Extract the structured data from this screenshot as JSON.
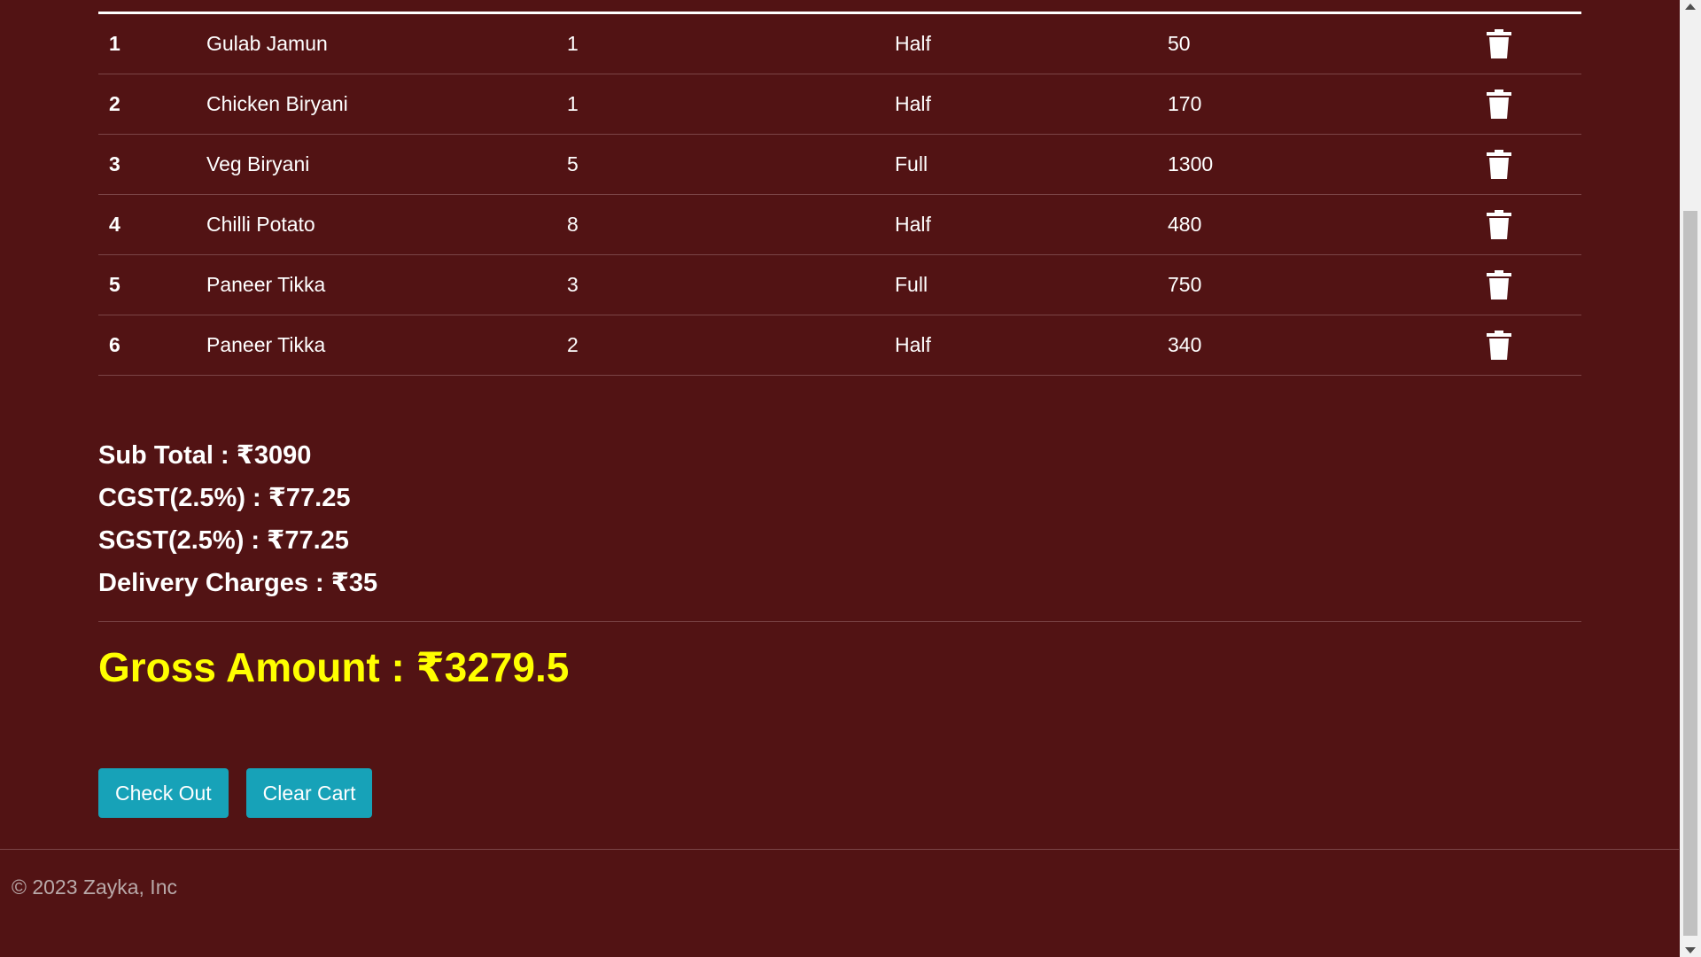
{
  "cart": {
    "rows": [
      {
        "num": "1",
        "name": "Gulab Jamun",
        "qty": "1",
        "size": "Half",
        "price": "50"
      },
      {
        "num": "2",
        "name": "Chicken Biryani",
        "qty": "1",
        "size": "Half",
        "price": "170"
      },
      {
        "num": "3",
        "name": "Veg Biryani",
        "qty": "5",
        "size": "Full",
        "price": "1300"
      },
      {
        "num": "4",
        "name": "Chilli Potato",
        "qty": "8",
        "size": "Half",
        "price": "480"
      },
      {
        "num": "5",
        "name": "Paneer Tikka",
        "qty": "3",
        "size": "Full",
        "price": "750"
      },
      {
        "num": "6",
        "name": "Paneer Tikka",
        "qty": "2",
        "size": "Half",
        "price": "340"
      }
    ],
    "delete_icon": "trash-icon"
  },
  "summary": {
    "subtotal": "Sub Total : ₹3090",
    "cgst": "CGST(2.5%) : ₹77.25",
    "sgst": "SGST(2.5%) : ₹77.25",
    "delivery": "Delivery Charges : ₹35",
    "gross": "Gross Amount : ₹3279.5"
  },
  "actions": {
    "checkout_label": "Check Out",
    "clear_label": "Clear Cart"
  },
  "footer": {
    "copyright": "© 2023 Zayka, Inc"
  },
  "colors": {
    "background": "#521314",
    "gross_amount": "#ffff00",
    "button": "#17a2b8"
  }
}
